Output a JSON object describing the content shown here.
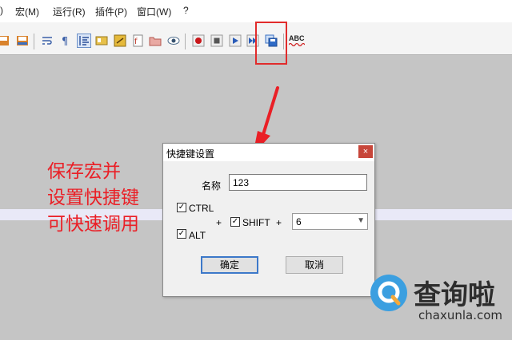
{
  "menubar": {
    "items": [
      "宏(M)",
      "运行(R)",
      "插件(P)",
      "窗口(W)",
      "?"
    ]
  },
  "toolbar": {
    "icons": [
      "save-icon",
      "save-all-icon",
      "wrap-icon",
      "paragraph-icon",
      "indent-guide-icon",
      "doc-map-icon",
      "fold-icon",
      "function-list-icon",
      "folder-icon",
      "eye-icon",
      "record-macro-icon",
      "stop-macro-icon",
      "play-macro-icon",
      "run-multiple-macro-icon",
      "save-macro-icon",
      "spellcheck-icon"
    ],
    "spellcheck_label": "ABC"
  },
  "annotation": {
    "lines": [
      "保存宏并",
      "设置快捷键",
      "可快速调用"
    ],
    "color": "#ea1f26"
  },
  "dialog": {
    "title": "快捷键设置",
    "close_glyph": "×",
    "name_label": "名称",
    "name_value": "123",
    "ctrl_label": "CTRL",
    "ctrl_checked": true,
    "alt_label": "ALT",
    "alt_checked": true,
    "shift_label": "SHIFT",
    "shift_checked": true,
    "plus": "+",
    "key_value": "6",
    "ok_label": "确定",
    "cancel_label": "取消"
  },
  "watermark": {
    "brand": "查询啦",
    "url": "chaxunla.com"
  },
  "colors": {
    "highlight": "#e12b2b",
    "close_button": "#c7463a",
    "default_button_border": "#3c78c9"
  }
}
